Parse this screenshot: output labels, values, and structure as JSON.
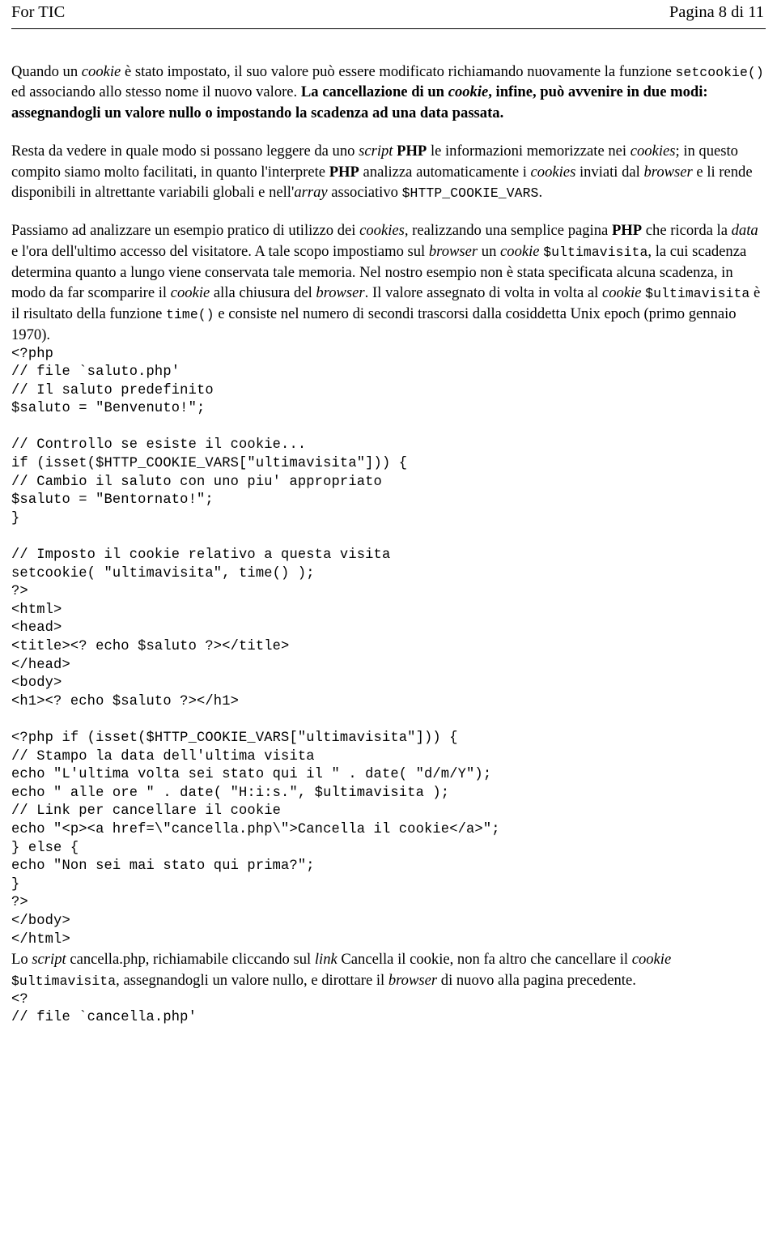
{
  "header": {
    "left": "For TIC",
    "right": "Pagina 8 di 11"
  },
  "paragraphs": {
    "p1": {
      "s1": "Quando un ",
      "i1": "cookie",
      "s2": " è stato impostato, il suo valore può essere modificato richiamando nuovamente la funzione ",
      "m1": "setcookie()",
      "s3": " ed associando allo stesso nome il nuovo valore. ",
      "b1": "La cancellazione di un ",
      "bi1": "cookie",
      "b2": ", infine, può avvenire in due modi: assegnandogli un valore nullo o impostando la scadenza ad una data passata."
    },
    "p2": {
      "s1": "Resta da vedere in quale modo si possano leggere da uno ",
      "i1": "script",
      "s2": " ",
      "b1": "PHP",
      "s3": " le informazioni memorizzate nei ",
      "i2": "cookies",
      "s4": "; in questo compito siamo molto facilitati, in quanto l'interprete ",
      "b2": "PHP",
      "s5": " analizza automaticamente i ",
      "i3": "cookies",
      "s6": " inviati dal ",
      "i4": "browser",
      "s7": " e li rende disponibili in altrettante variabili globali e nell'",
      "i5": "array",
      "s8": " associativo ",
      "m1": "$HTTP_COOKIE_VARS",
      "s9": "."
    },
    "p3": {
      "s1": "Passiamo ad analizzare un esempio pratico di utilizzo dei ",
      "i1": "cookies",
      "s2": ", realizzando una semplice pagina ",
      "b1": "PHP",
      "s3": " che ricorda la ",
      "i2": "data",
      "s4": " e l'ora dell'ultimo accesso del visitatore. A tale scopo impostiamo sul ",
      "i3": "browser",
      "s5": " un ",
      "i4": "cookie",
      "s6": " ",
      "m1": "$ultimavisita",
      "s7": ", la cui scadenza determina quanto a lungo viene conservata tale memoria. Nel nostro esempio non è stata specificata alcuna scadenza, in modo da far scomparire il ",
      "i5": "cookie",
      "s8": " alla chiusura del ",
      "i6": "browser",
      "s9": ". Il valore assegnato di volta in volta al ",
      "i7": "cookie",
      "s10": " ",
      "m2": "$ultimavisita",
      "s11": " è il risultato della funzione ",
      "m3": "time()",
      "s12": " e consiste nel numero di secondi trascorsi dalla cosiddetta Unix epoch (primo gennaio 1970)."
    },
    "p4": {
      "s1": "Lo ",
      "i1": "script",
      "s2": " cancella.php, richiamabile cliccando sul ",
      "i2": "link",
      "s3": " Cancella il cookie, non fa altro che cancellare il ",
      "i3": "cookie",
      "s4": " ",
      "m1": "$ultimavisita",
      "s5": ", assegnandogli un valore nullo, e dirottare il ",
      "i4": "browser",
      "s6": " di nuovo alla pagina precedente."
    }
  },
  "code_listings": {
    "saluto_php": "<?php\n// file `saluto.php'\n// Il saluto predefinito\n$saluto = \"Benvenuto!\";\n\n// Controllo se esiste il cookie...\nif (isset($HTTP_COOKIE_VARS[\"ultimavisita\"])) {\n// Cambio il saluto con uno piu' appropriato\n$saluto = \"Bentornato!\";\n}\n\n// Imposto il cookie relativo a questa visita\nsetcookie( \"ultimavisita\", time() );\n?>\n<html>\n<head>\n<title><? echo $saluto ?></title>\n</head>\n<body>\n<h1><? echo $saluto ?></h1>\n\n<?php if (isset($HTTP_COOKIE_VARS[\"ultimavisita\"])) {\n// Stampo la data dell'ultima visita\necho \"L'ultima volta sei stato qui il \" . date( \"d/m/Y\");\necho \" alle ore \" . date( \"H:i:s.\", $ultimavisita );\n// Link per cancellare il cookie\necho \"<p><a href=\\\"cancella.php\\\">Cancella il cookie</a>\";\n} else {\necho \"Non sei mai stato qui prima?\";\n}\n?>\n</body>\n</html>",
    "cancella_php": "<?\n// file `cancella.php'"
  }
}
